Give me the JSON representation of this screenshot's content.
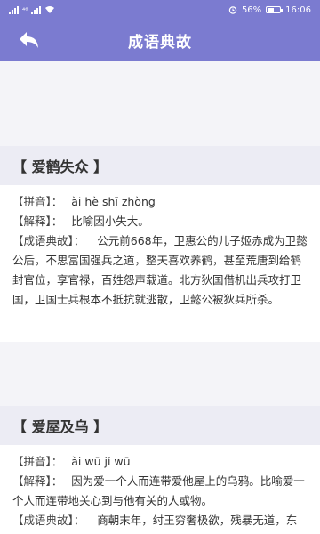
{
  "status": {
    "carrier": "⁴⁶",
    "battery": "56%",
    "battery_level": 0.56,
    "time": "16:06"
  },
  "header": {
    "title": "成语典故",
    "back_icon": "back-arrow-icon"
  },
  "idioms": [
    {
      "title": "【 爱鹤失众 】",
      "pinyin_label": "【拼音】：",
      "pinyin": "ài hè shī zhòng",
      "meaning_label": "【解释】：",
      "meaning": "比喻因小失大。",
      "story_label": "【成语典故】：",
      "story": "公元前668年，卫惠公的儿子姬赤成为卫懿公后，不思富国强兵之道，整天喜欢养鹤，甚至荒唐到给鹤封官位，享官禄，百姓怨声载道。北方狄国借机出兵攻打卫国，卫国士兵根本不抵抗就逃散，卫懿公被狄兵所杀。"
    },
    {
      "title": "【 爱屋及乌 】",
      "pinyin_label": "【拼音】：",
      "pinyin": "ài wū jí wū",
      "meaning_label": "【解释】：",
      "meaning": "因为爱一个人而连带爱他屋上的乌鸦。比喻爱一个人而连带地关心到与他有关的人或物。",
      "story_label": "【成语典故】：",
      "story": "商朝末年，纣王穷奢极欲，残暴无道，东方诸侯国的首领姬昌决心推翻商朝统治，积极练"
    }
  ]
}
